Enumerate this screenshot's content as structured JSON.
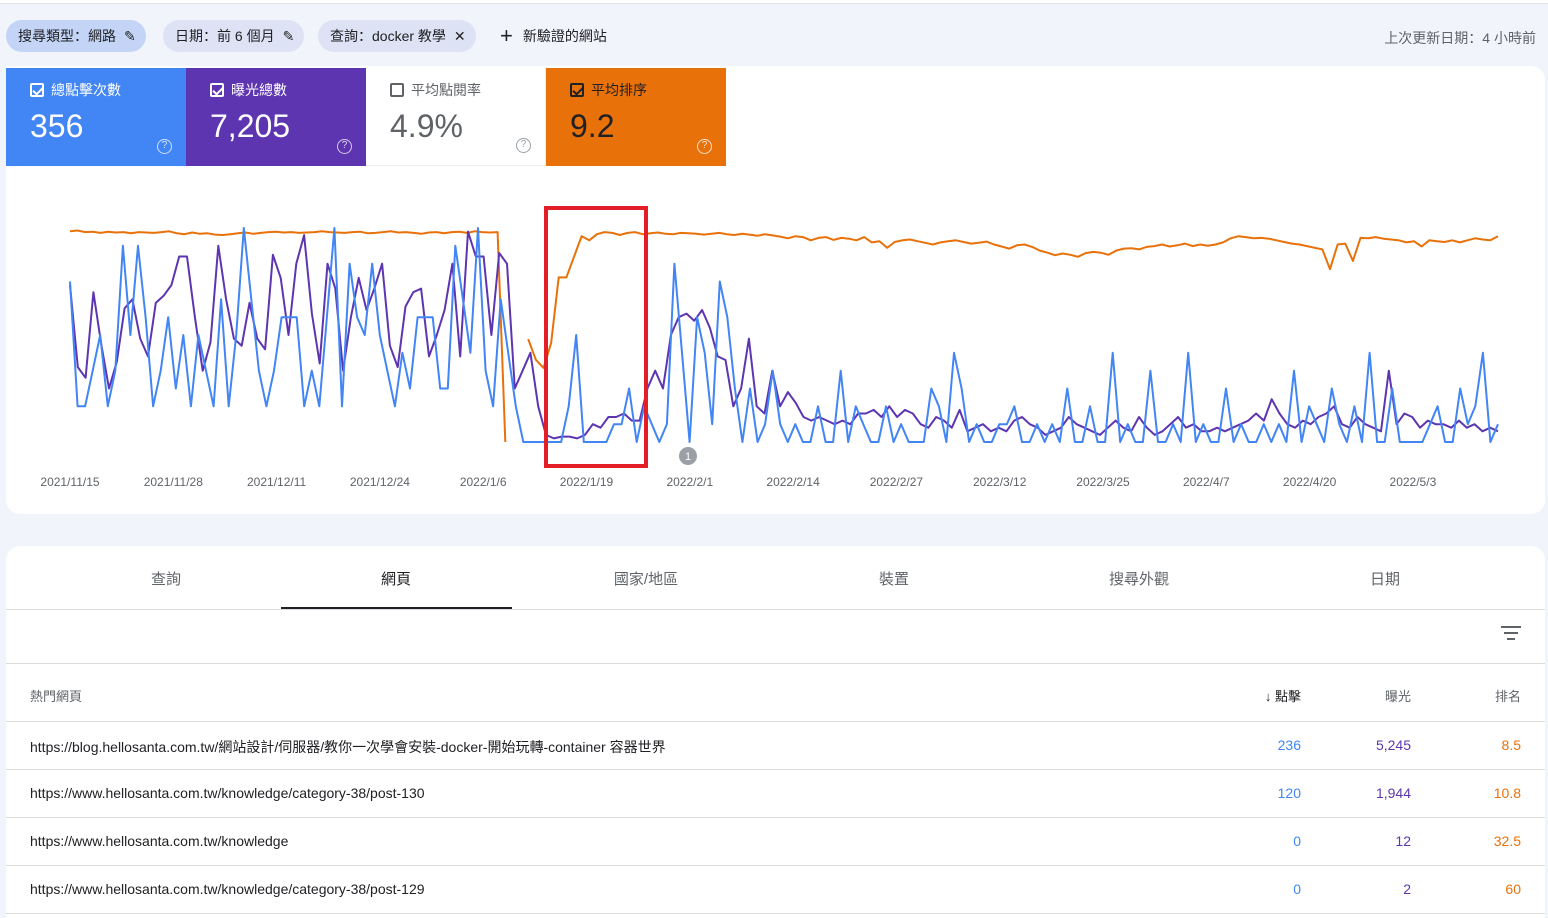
{
  "filters": {
    "search_type": "搜尋類型：網路",
    "date": "日期：前 6 個月",
    "query": "查詢：docker 教學",
    "add_site": "新驗證的網站",
    "updated": "上次更新日期：4 小時前"
  },
  "metrics": [
    {
      "label": "總點擊次數",
      "value": "356"
    },
    {
      "label": "曝光總數",
      "value": "7,205"
    },
    {
      "label": "平均點閱率",
      "value": "4.9%"
    },
    {
      "label": "平均排序",
      "value": "9.2"
    }
  ],
  "colors": {
    "clicks": "#4285f4",
    "impressions": "#5e35b1",
    "position": "#e8710a",
    "highlight": "#e41e26"
  },
  "chart_data": {
    "type": "line",
    "x_ticks": [
      "2021/11/15",
      "2021/11/28",
      "2021/12/11",
      "2021/12/24",
      "2022/1/6",
      "2022/1/19",
      "2022/2/1",
      "2022/2/14",
      "2022/2/27",
      "2022/3/12",
      "2022/3/25",
      "2022/4/7",
      "2022/4/20",
      "2022/5/3"
    ],
    "annotation": "1",
    "grid": false,
    "series": [
      {
        "key": "position",
        "values": [
          8.8,
          8.6,
          9.0,
          8.9,
          9.2,
          8.9,
          9.1,
          9.0,
          9.3,
          9.0,
          9.1,
          9.2,
          9.0,
          8.8,
          9.3,
          9.5,
          9.1,
          9.4,
          9.3,
          9.6,
          9.7,
          9.5,
          9.3,
          9.1,
          9.4,
          9.2,
          9.0,
          8.9,
          9.1,
          9.0,
          9.2,
          9.1,
          9.0,
          8.8,
          9.0,
          9.1,
          9.2,
          9.0,
          8.9,
          9.3,
          9.2,
          9.0,
          8.8,
          9.1,
          9.0,
          9.2,
          9.4,
          9.1,
          9.0,
          9.3,
          9.0,
          8.9,
          9.2,
          8.8,
          9.0,
          9.1,
          9.0,
          60,
          null,
          null,
          35,
          40,
          42,
          36,
          20,
          20,
          15,
          10,
          11,
          9.5,
          9.0,
          9.2,
          9.7,
          9.2,
          9.0,
          9.5,
          9.3,
          9.1,
          9.4,
          9.5,
          9.2,
          9.3,
          9.4,
          9.6,
          9.4,
          9.2,
          9.5,
          9.7,
          9.4,
          9.6,
          9.9,
          9.5,
          9.8,
          10.1,
          10.5,
          10.0,
          10.2,
          11.0,
          10.4,
          10.2,
          10.9,
          10.4,
          10.6,
          11.0,
          10.2,
          11.5,
          11.2,
          12.8,
          11.4,
          11.0,
          10.8,
          11.2,
          11.6,
          12.0,
          11.5,
          11.2,
          11.0,
          11.4,
          11.8,
          11.6,
          11.3,
          12.0,
          12.5,
          13.0,
          12.2,
          12.0,
          12.6,
          13.5,
          14.0,
          14.6,
          14.2,
          14.5,
          15.0,
          14.1,
          13.8,
          14.0,
          14.5,
          13.5,
          13.0,
          12.9,
          13.2,
          12.6,
          12.4,
          12.0,
          12.5,
          12.2,
          11.8,
          12.4,
          12.0,
          12.3,
          12.0,
          11.5,
          10.5,
          10.0,
          10.2,
          10.5,
          10.4,
          10.6,
          11.0,
          11.4,
          11.8,
          12.0,
          12.4,
          12.8,
          13.2,
          18.0,
          12.0,
          11.8,
          16.0,
          10.4,
          10.5,
          10.2,
          10.6,
          10.8,
          11.0,
          11.5,
          11.2,
          12.5,
          11.0,
          11.2,
          11.4,
          11.0,
          11.5,
          11.0,
          10.5,
          10.8,
          11.0,
          10.0
        ]
      },
      {
        "key": "impressions",
        "values": [
          88,
          42,
          36,
          84,
          55,
          30,
          45,
          75,
          80,
          58,
          48,
          78,
          82,
          88,
          104,
          104,
          70,
          40,
          56,
          110,
          80,
          58,
          54,
          78,
          58,
          52,
          105,
          92,
          60,
          100,
          116,
          72,
          44,
          100,
          86,
          40,
          70,
          92,
          74,
          86,
          100,
          54,
          42,
          76,
          84,
          86,
          48,
          60,
          74,
          100,
          48,
          118,
          104,
          104,
          60,
          106,
          100,
          30,
          40,
          50,
          20,
          4,
          2,
          3,
          3,
          2,
          4,
          10,
          8,
          14,
          14,
          16,
          12,
          12,
          30,
          40,
          30,
          60,
          70,
          72,
          68,
          74,
          64,
          48,
          46,
          20,
          30,
          58,
          20,
          16,
          40,
          20,
          28,
          22,
          14,
          12,
          14,
          12,
          10,
          12,
          10,
          16,
          16,
          18,
          14,
          20,
          14,
          18,
          16,
          10,
          8,
          14,
          12,
          8,
          18,
          6,
          8,
          10,
          6,
          8,
          6,
          12,
          14,
          10,
          8,
          4,
          6,
          8,
          14,
          10,
          8,
          6,
          4,
          8,
          12,
          8,
          6,
          14,
          8,
          4,
          6,
          10,
          14,
          8,
          10,
          6,
          6,
          8,
          6,
          8,
          10,
          12,
          16,
          12,
          24,
          16,
          10,
          8,
          12,
          10,
          14,
          16,
          20,
          10,
          8,
          14,
          10,
          8,
          6,
          40,
          10,
          16,
          14,
          8,
          12,
          10,
          10,
          8,
          12,
          8,
          10,
          6,
          8,
          6
        ]
      },
      {
        "key": "clicks",
        "values": [
          9,
          2,
          2,
          4,
          6,
          2,
          4,
          11,
          6,
          11,
          7,
          2,
          4,
          7,
          3,
          6,
          2,
          6,
          4,
          2,
          8,
          2,
          6,
          12,
          8,
          4,
          2,
          4,
          7,
          7,
          7,
          2,
          4,
          2,
          7,
          12,
          2,
          10,
          7,
          6,
          10,
          6,
          4,
          2,
          5,
          3,
          7,
          7,
          7,
          3,
          3,
          11,
          8,
          5,
          12,
          4,
          2,
          8,
          5,
          2,
          0,
          0,
          0,
          0,
          0,
          0,
          2,
          6,
          0,
          0,
          0,
          0,
          1,
          1,
          3,
          0,
          2,
          1,
          0,
          1,
          10,
          5,
          0,
          7,
          5,
          1,
          9,
          7,
          3,
          0,
          3,
          0,
          1,
          4,
          1,
          0,
          1,
          0,
          0,
          2,
          0,
          0,
          4,
          0,
          2,
          1,
          0,
          0,
          2,
          0,
          1,
          0,
          0,
          0,
          3,
          2,
          0,
          5,
          3,
          0,
          1,
          0,
          0,
          1,
          1,
          2,
          0,
          0,
          1,
          0,
          1,
          0,
          3,
          0,
          0,
          2,
          0,
          0,
          5,
          0,
          1,
          0,
          0,
          4,
          0,
          0,
          1,
          0,
          5,
          0,
          1,
          0,
          0,
          3,
          0,
          1,
          0,
          0,
          1,
          0,
          1,
          0,
          4,
          0,
          2,
          1,
          0,
          3,
          1,
          0,
          2,
          0,
          5,
          0,
          0,
          3,
          0,
          0,
          0,
          0,
          1,
          2,
          0,
          0,
          3,
          1,
          2,
          5,
          0,
          1
        ]
      }
    ]
  },
  "tabs": [
    "查詢",
    "網頁",
    "國家/地區",
    "裝置",
    "搜尋外觀",
    "日期"
  ],
  "table": {
    "headers": [
      "熱門網頁",
      "點擊",
      "曝光",
      "排名"
    ],
    "rows": [
      [
        "https://blog.hellosanta.com.tw/網站設計/伺服器/教你一次學會安裝-docker-開始玩轉-container 容器世界",
        "236",
        "5,245",
        "8.5"
      ],
      [
        "https://www.hellosanta.com.tw/knowledge/category-38/post-130",
        "120",
        "1,944",
        "10.8"
      ],
      [
        "https://www.hellosanta.com.tw/knowledge",
        "0",
        "12",
        "32.5"
      ],
      [
        "https://www.hellosanta.com.tw/knowledge/category-38/post-129",
        "0",
        "2",
        "60"
      ]
    ]
  }
}
